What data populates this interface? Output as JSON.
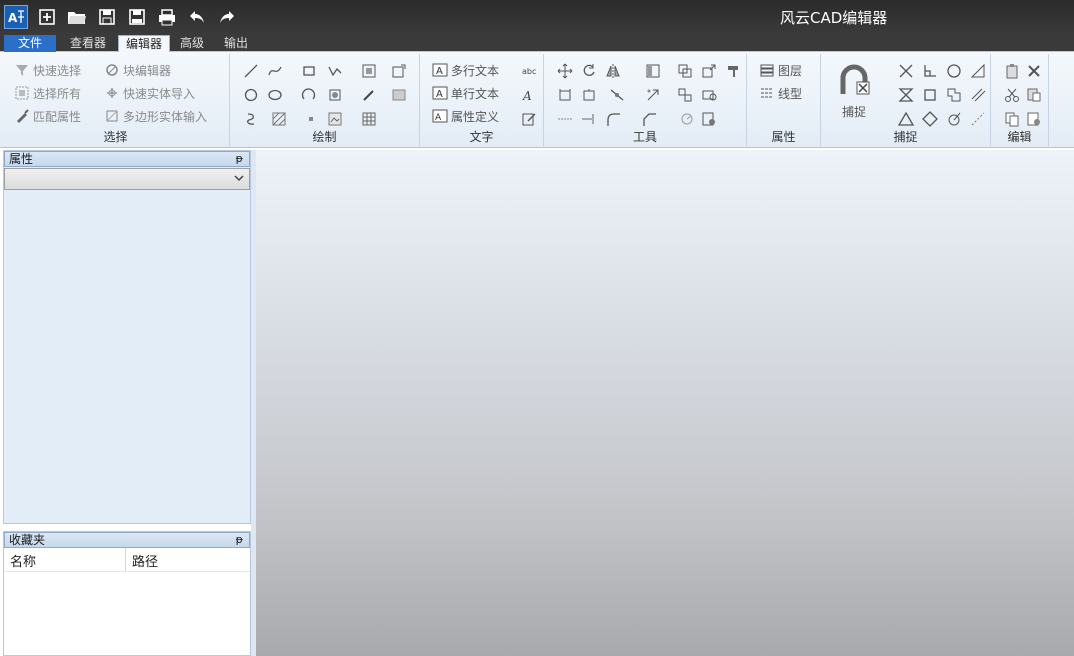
{
  "app": {
    "title": "风云CAD编辑器"
  },
  "quick_access": [
    "app-logo",
    "new-icon",
    "open-icon",
    "save-icon",
    "save-as-pdf-icon",
    "print-icon",
    "undo-icon",
    "redo-icon"
  ],
  "menu_tabs": {
    "file": "文件",
    "viewer": "查看器",
    "editor": "编辑器",
    "advanced": "高级",
    "output": "输出"
  },
  "ribbon": {
    "select": {
      "label": "选择",
      "quick_select": "快速选择",
      "select_all": "选择所有",
      "match_props": "匹配属性",
      "block_editor": "块编辑器",
      "quick_entity_import": "快速实体导入",
      "polygon_entity_input": "多边形实体输入"
    },
    "draw": {
      "label": "绘制"
    },
    "text": {
      "label": "文字",
      "multiline": "多行文本",
      "single_line": "单行文本",
      "attr_def": "属性定义"
    },
    "tools": {
      "label": "工具"
    },
    "properties": {
      "label": "属性",
      "layers": "图层",
      "linetype": "线型"
    },
    "snap": {
      "label": "捕捉",
      "snap_button": "捕捉"
    },
    "edit": {
      "label": "编辑"
    }
  },
  "panels": {
    "properties": {
      "title": "属性",
      "pin": "ᵽ",
      "selected": ""
    },
    "favorites": {
      "title": "收藏夹",
      "pin": "ᵽ",
      "columns": [
        "名称",
        "路径"
      ]
    }
  },
  "colors": {
    "titlebar": "#333333",
    "file_tab": "#2c6fc8",
    "ribbon": "#e9f0f8",
    "canvas_top": "#eef3fa",
    "canvas_bottom": "#a8a9ad"
  }
}
